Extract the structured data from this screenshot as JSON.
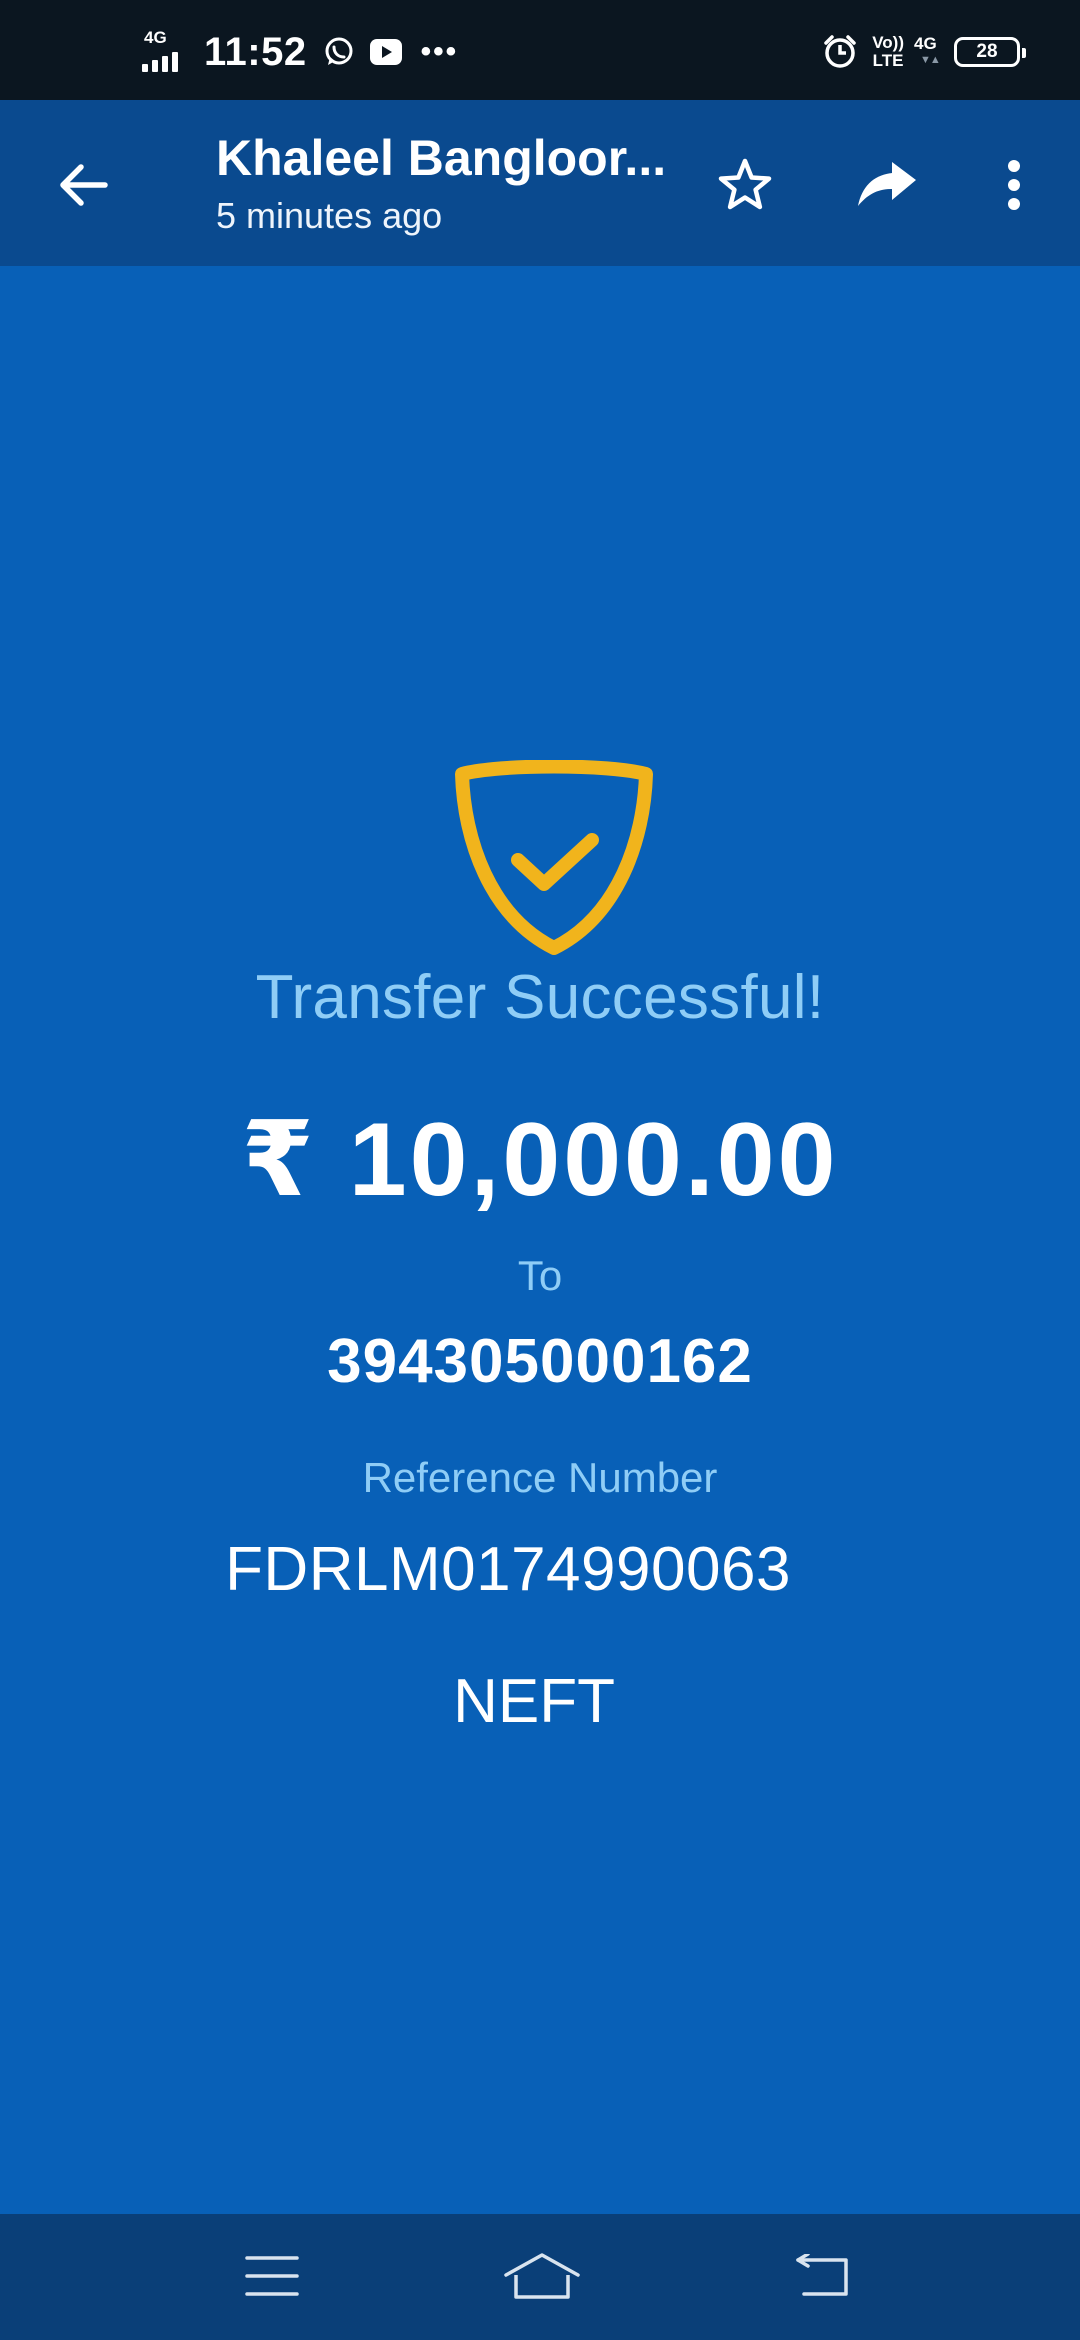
{
  "status_bar": {
    "network": "4G",
    "time": "11:52",
    "volte_line1": "Vo))",
    "volte_line2": "LTE",
    "network2": "4G",
    "battery": "28",
    "icons": [
      "whatsapp-icon",
      "youtube-icon",
      "more-notifications-icon",
      "alarm-icon",
      "signal-icon",
      "battery-icon"
    ]
  },
  "app_bar": {
    "title": "Khaleel Bangloor...",
    "subtitle": "5 minutes ago",
    "icons": [
      "back-arrow-icon",
      "star-icon",
      "share-icon",
      "more-vert-icon"
    ]
  },
  "transfer": {
    "headline": "Transfer Successful!",
    "amount": "₹ 10,000.00",
    "to_label": "To",
    "account": "394305000162",
    "reference_label": "Reference Number",
    "reference_number": "FDRLM0174990063",
    "mode": "NEFT",
    "icon": "shield-check-icon"
  },
  "nav_bar": {
    "icons": [
      "menu-icon",
      "home-icon",
      "back-icon"
    ]
  },
  "colors": {
    "status_bar_bg": "#0b1620",
    "app_bar_bg": "#0a4a8f",
    "content_bg": "#0860b7",
    "nav_bar_bg": "#0a3f78",
    "accent_text": "#8fcdf6",
    "shield_gold": "#f1b41c"
  }
}
